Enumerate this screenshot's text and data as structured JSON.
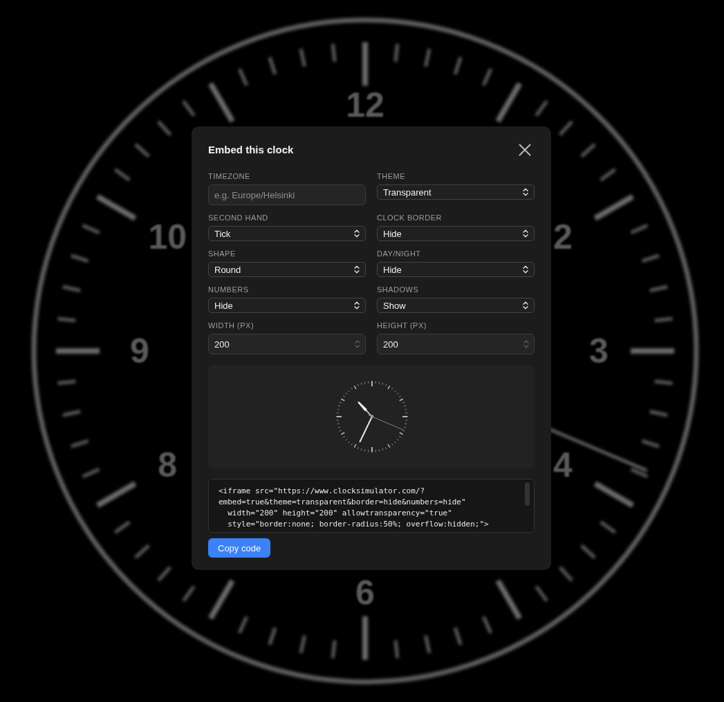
{
  "background_clock": {
    "numbers": [
      "12",
      "10",
      "2",
      "9",
      "3",
      "8",
      "4",
      "6"
    ]
  },
  "dialog": {
    "title": "Embed this clock",
    "fields": [
      {
        "kind": "text",
        "label": "TIMEZONE",
        "placeholder": "e.g. Europe/Helsinki"
      },
      {
        "kind": "select",
        "label": "THEME",
        "value": "Transparent"
      },
      {
        "kind": "select",
        "label": "SECOND HAND",
        "value": "Tick"
      },
      {
        "kind": "select",
        "label": "CLOCK BORDER",
        "value": "Hide"
      },
      {
        "kind": "select",
        "label": "SHAPE",
        "value": "Round"
      },
      {
        "kind": "select",
        "label": "DAY/NIGHT",
        "value": "Hide"
      },
      {
        "kind": "select",
        "label": "NUMBERS",
        "value": "Hide"
      },
      {
        "kind": "select",
        "label": "SHADOWS",
        "value": "Show"
      },
      {
        "kind": "number",
        "label": "WIDTH (PX)",
        "value": "200"
      },
      {
        "kind": "number",
        "label": "HEIGHT (PX)",
        "value": "200"
      }
    ],
    "embed_code": "<iframe src=\"https://www.clocksimulator.com/?\nembed=true&theme=transparent&border=hide&numbers=hide\"\n  width=\"200\" height=\"200\" allowtransparency=\"true\"\n  style=\"border:none; border-radius:50%; overflow:hidden;\">",
    "copy_button": "Copy code"
  }
}
